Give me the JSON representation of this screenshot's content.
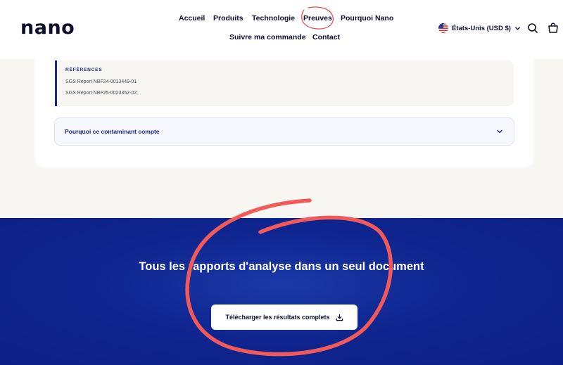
{
  "header": {
    "logo": "nano",
    "nav_row1": [
      "Accueil",
      "Produits",
      "Technologie",
      "Preuves",
      "Pourquoi Nano"
    ],
    "nav_row2": [
      "Suivre ma commande",
      "Contact"
    ],
    "region": "États-Unis (USD $)",
    "icons": [
      "us-flag-icon",
      "chevron-down-icon",
      "search-icon",
      "cart-icon"
    ]
  },
  "references": {
    "title": "RÉFÉRENCES",
    "items": [
      "SGS Report NBF24-0013449-01",
      "SGS Report NBF25-0023352-02"
    ]
  },
  "accordion": {
    "label": "Pourquoi ce contaminant compte"
  },
  "cta": {
    "title": "Tous les rapports d'analyse dans un seul document",
    "button_label": "Télécharger les résultats complets"
  },
  "colors": {
    "navy": "#1b2783",
    "section_blue": "#0f258f",
    "annotation_red": "#f25a5a"
  }
}
